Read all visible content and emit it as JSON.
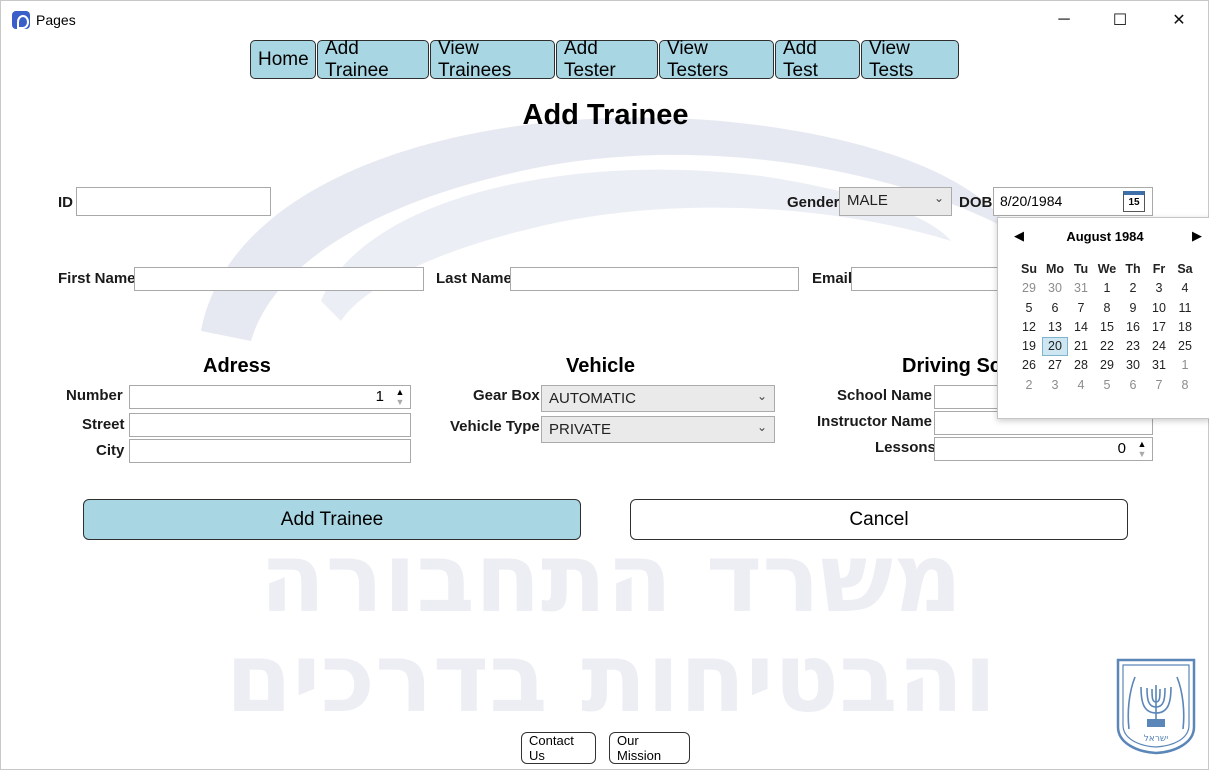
{
  "window": {
    "title": "Pages",
    "minimize_glyph": "─",
    "maximize_glyph": "☐",
    "close_glyph": "✕"
  },
  "nav": [
    "Home",
    "Add Trainee",
    "View Trainees",
    "Add Tester",
    "View Testers",
    "Add Test",
    "View Tests"
  ],
  "page_title": "Add Trainee",
  "form": {
    "id_label": "ID",
    "id_value": "",
    "gender_label": "Gender",
    "gender_value": "MALE",
    "dob_label": "DOB",
    "dob_value": "8/20/1984",
    "calendar_icon_text": "15",
    "first_name_label": "First Name",
    "first_name_value": "",
    "last_name_label": "Last Name",
    "last_name_value": "",
    "email_label": "Email",
    "email_value": ""
  },
  "address": {
    "title": "Adress",
    "number_label": "Number",
    "number_value": "1",
    "street_label": "Street",
    "street_value": "",
    "city_label": "City",
    "city_value": ""
  },
  "vehicle": {
    "title": "Vehicle",
    "gearbox_label": "Gear Box",
    "gearbox_value": "AUTOMATIC",
    "type_label": "Vehicle Type",
    "type_value": "PRIVATE"
  },
  "school": {
    "title": "Driving Sc",
    "school_name_label": "School Name",
    "instructor_label": "Instructor Name",
    "lessons_label": "Lessons",
    "lessons_value": "0"
  },
  "actions": {
    "add_label": "Add Trainee",
    "cancel_label": "Cancel"
  },
  "footer": {
    "contact_label": "Contact Us",
    "mission_label": "Our Mission"
  },
  "calendar": {
    "month_label": "August 1984",
    "days_of_week": [
      "Su",
      "Mo",
      "Tu",
      "We",
      "Th",
      "Fr",
      "Sa"
    ],
    "weeks": [
      [
        "29",
        "30",
        "31",
        "1",
        "2",
        "3",
        "4"
      ],
      [
        "5",
        "6",
        "7",
        "8",
        "9",
        "10",
        "11"
      ],
      [
        "12",
        "13",
        "14",
        "15",
        "16",
        "17",
        "18"
      ],
      [
        "19",
        "20",
        "21",
        "22",
        "23",
        "24",
        "25"
      ],
      [
        "26",
        "27",
        "28",
        "29",
        "30",
        "31",
        "1"
      ],
      [
        "2",
        "3",
        "4",
        "5",
        "6",
        "7",
        "8"
      ]
    ],
    "selected_day": "20"
  },
  "watermark": {
    "line1": "משרד התחבורה",
    "line2": "והבטיחות בדרכים",
    "emblem": "ישראל"
  },
  "colors": {
    "accent_button": "#a9d6e3",
    "selected_day": "#cde6f1"
  }
}
